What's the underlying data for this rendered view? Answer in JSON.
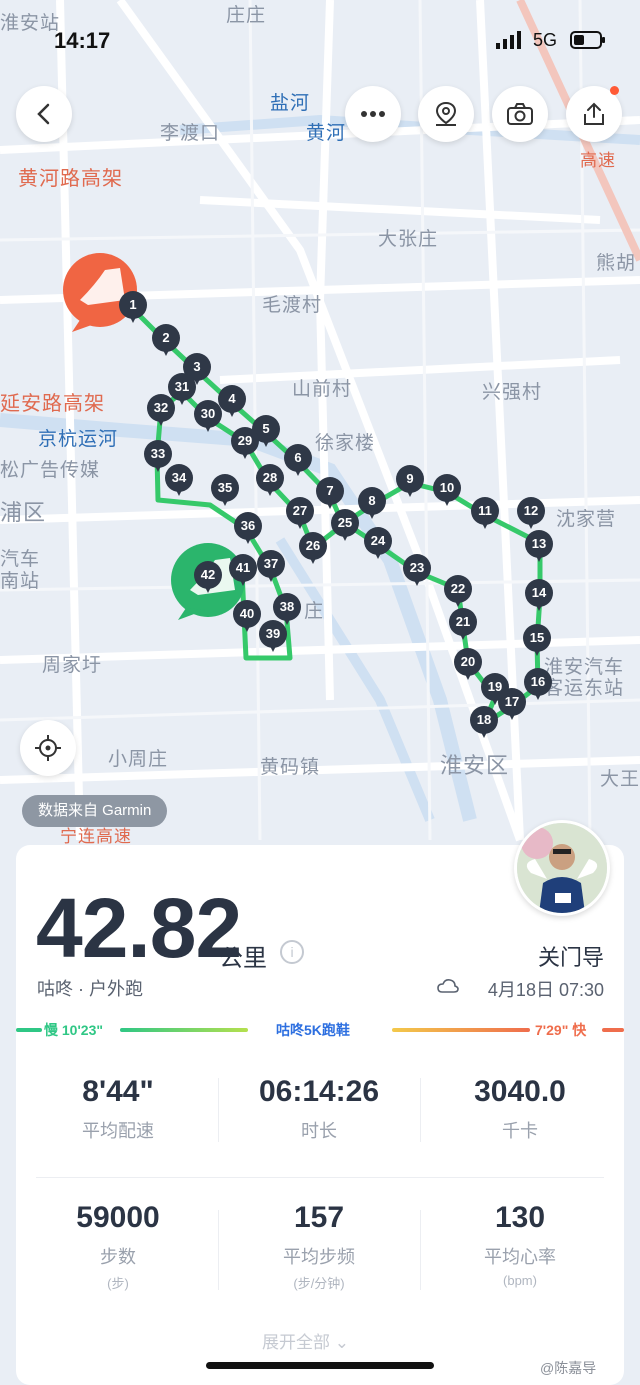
{
  "status": {
    "time": "14:17",
    "network": "5G"
  },
  "colors": {
    "route_green": "#36c96a",
    "route_light": "#b7e26c",
    "marker": "#2f3847",
    "start_orange": "#f06543",
    "end_green": "#2bb56c"
  },
  "map": {
    "labels": [
      "淮安站",
      "庄庄",
      "盐河",
      "李渡口",
      "黄河",
      "黄河路高架",
      "大张庄",
      "毛渡村",
      "熊胡",
      "山前村",
      "兴强村",
      "延安路高架",
      "京杭运河",
      "徐家楼",
      "松广告传媒",
      "浦区",
      "沈家营",
      "汽车",
      "南站",
      "周家圩",
      "淮安汽车",
      "客运东站",
      "小周庄",
      "黄码镇",
      "淮安区",
      "大王",
      "宁连高速",
      "高速",
      "庄"
    ],
    "markers": [
      "1",
      "2",
      "3",
      "4",
      "5",
      "6",
      "7",
      "8",
      "9",
      "10",
      "11",
      "12",
      "13",
      "14",
      "15",
      "16",
      "17",
      "18",
      "19",
      "20",
      "21",
      "22",
      "23",
      "24",
      "25",
      "26",
      "27",
      "28",
      "29",
      "30",
      "31",
      "32",
      "33",
      "34",
      "35",
      "36",
      "37",
      "38",
      "39",
      "40",
      "41",
      "42"
    ],
    "source": "数据来自 Garmin"
  },
  "summary": {
    "distance": "42.82",
    "unit": "公里",
    "activity": "咕咚 · 户外跑",
    "user": "关门导",
    "date": "4月18日 07:30",
    "pace_slow": "慢 10'23\"",
    "pace_center": "咕咚5K跑鞋",
    "pace_fast": "7'29\" 快"
  },
  "stats_row1": [
    {
      "value": "8'44\"",
      "label": "平均配速"
    },
    {
      "value": "06:14:26",
      "label": "时长"
    },
    {
      "value": "3040.0",
      "label": "千卡"
    }
  ],
  "stats_row2": [
    {
      "value": "59000",
      "label": "步数",
      "unit": "(步)"
    },
    {
      "value": "157",
      "label": "平均步频",
      "unit": "(步/分钟)"
    },
    {
      "value": "130",
      "label": "平均心率",
      "unit": "(bpm)"
    }
  ],
  "footer": {
    "expand": "展开全部",
    "watermark": "@陈嘉导"
  }
}
